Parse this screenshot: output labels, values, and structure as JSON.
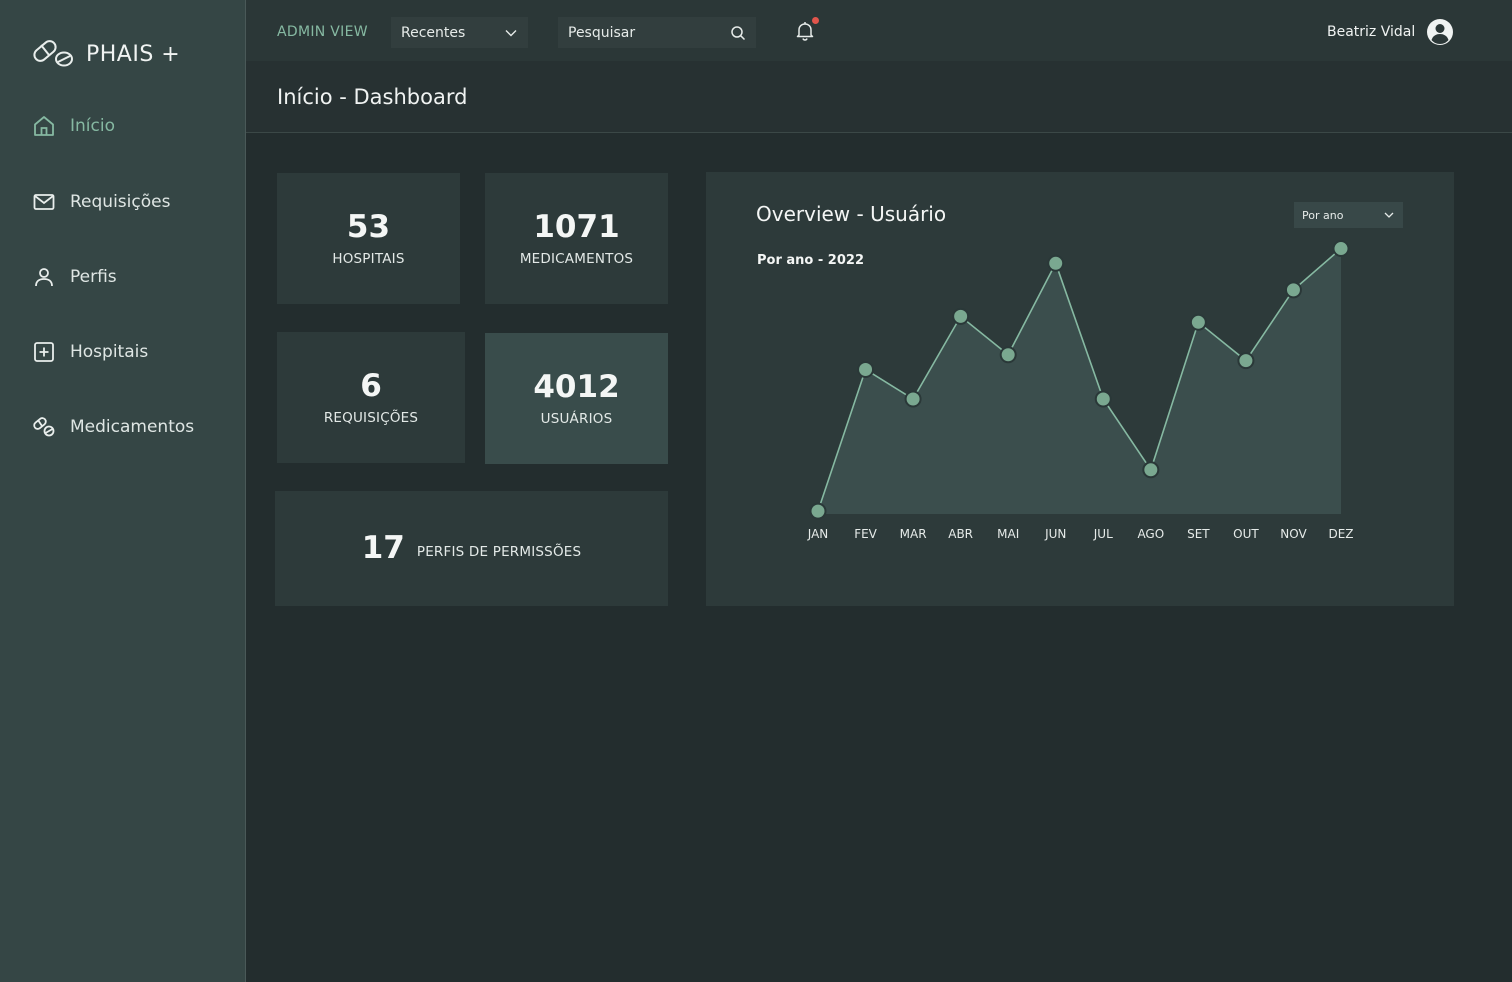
{
  "brand": {
    "name": "PHAIS +",
    "logo_icon": "pills-icon"
  },
  "sidebar": {
    "items": [
      {
        "label": "Início",
        "icon": "home-icon",
        "active": true
      },
      {
        "label": "Requisições",
        "icon": "mail-icon",
        "active": false
      },
      {
        "label": "Perfis",
        "icon": "user-icon",
        "active": false
      },
      {
        "label": "Hospitais",
        "icon": "plus-square-icon",
        "active": false
      },
      {
        "label": "Medicamentos",
        "icon": "pills-icon",
        "active": false
      }
    ]
  },
  "topbar": {
    "admin_view": "ADMIN VIEW",
    "recent_select": "Recentes",
    "search_placeholder": "Pesquisar",
    "user_name": "Beatriz Vidal",
    "has_notification": true
  },
  "page": {
    "title": "Início - Dashboard"
  },
  "stats": {
    "hospitais": {
      "value": "53",
      "label": "HOSPITAIS"
    },
    "medicamentos": {
      "value": "1071",
      "label": "MEDICAMENTOS"
    },
    "requisicoes": {
      "value": "6",
      "label": "REQUISIÇÕES"
    },
    "usuarios": {
      "value": "4012",
      "label": "USUÁRIOS"
    },
    "perfis": {
      "value": "17",
      "label": "PERFIS DE PERMISSÕES"
    }
  },
  "overview": {
    "title": "Overview - Usuário",
    "period_select": "Por ano",
    "subtitle": "Por ano - 2022"
  },
  "colors": {
    "accent": "#86b9a2",
    "point_fill": "#7aa890",
    "area_fill": "#3b4e4d",
    "notification": "#e0554c"
  },
  "chart_data": {
    "type": "area",
    "categories": [
      "JAN",
      "FEV",
      "MAR",
      "ABR",
      "MAI",
      "JUN",
      "JUL",
      "AGO",
      "SET",
      "OUT",
      "NOV",
      "DEZ"
    ],
    "values": [
      2,
      50,
      40,
      68,
      55,
      86,
      40,
      16,
      66,
      53,
      77,
      91
    ],
    "ylim": [
      0,
      100
    ],
    "grid": false,
    "legend": "none"
  }
}
